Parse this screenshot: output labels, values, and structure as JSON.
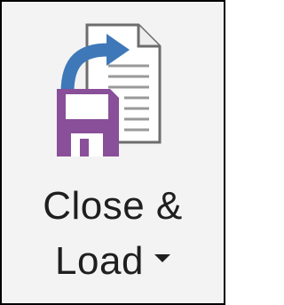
{
  "button": {
    "label_line1": "Close &",
    "label_line2": "Load",
    "icon": "close-and-load-icon",
    "dropdown_icon": "dropdown-caret-icon"
  },
  "colors": {
    "frame_border": "#000000",
    "background": "#f3f3f3",
    "arrow": "#3e78b8",
    "floppy": "#8a4f99",
    "document": "#ffffff"
  }
}
